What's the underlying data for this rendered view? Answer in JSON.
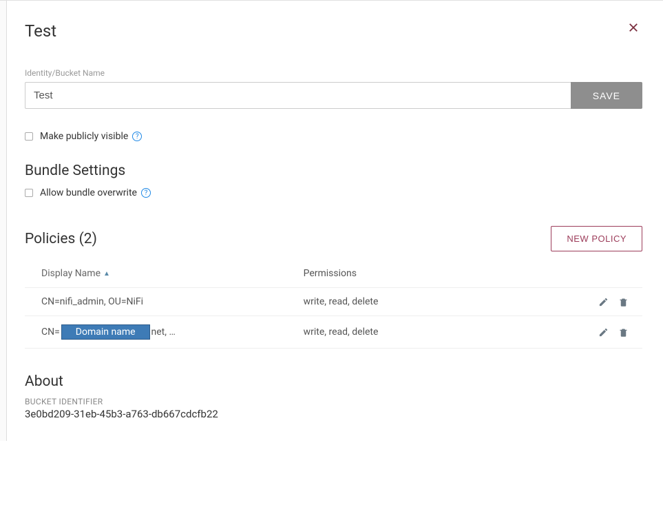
{
  "header": {
    "title": "Test"
  },
  "identity": {
    "label": "Identity/Bucket Name",
    "value": "Test",
    "save_label": "SAVE"
  },
  "visibility": {
    "label": "Make publicly visible"
  },
  "bundle": {
    "section_title": "Bundle Settings",
    "overwrite_label": "Allow bundle overwrite"
  },
  "policies": {
    "title": "Policies (2)",
    "new_button": "NEW POLICY",
    "columns": {
      "name": "Display Name",
      "perm": "Permissions"
    },
    "rows": [
      {
        "display_name_prefix": "CN=nifi_admin, OU=NiFi",
        "display_name_redaction": "",
        "display_name_suffix": "",
        "permissions": "write, read, delete"
      },
      {
        "display_name_prefix": "CN=",
        "display_name_redaction": "Domain name",
        "display_name_suffix": "net, …",
        "permissions": "write, read, delete"
      }
    ]
  },
  "about": {
    "title": "About",
    "id_label": "BUCKET IDENTIFIER",
    "id_value": "3e0bd209-31eb-45b3-a763-db667cdcfb22"
  }
}
